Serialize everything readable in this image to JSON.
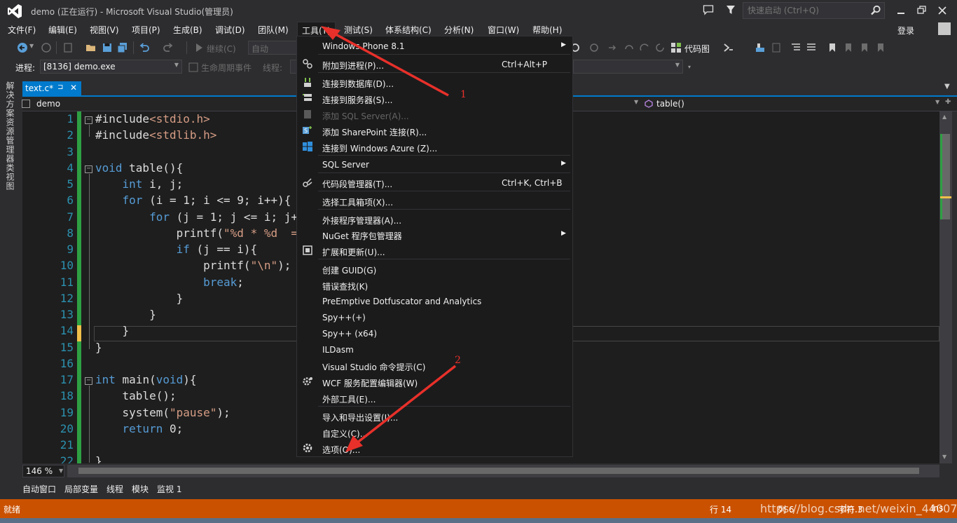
{
  "window": {
    "title": "demo (正在运行) - Microsoft Visual Studio(管理员)",
    "quick_launch_placeholder": "快速启动 (Ctrl+Q)",
    "login": "登录"
  },
  "menubar": {
    "items": [
      "文件(F)",
      "编辑(E)",
      "视图(V)",
      "项目(P)",
      "生成(B)",
      "调试(D)",
      "团队(M)",
      "工具(T)",
      "测试(S)",
      "体系结构(C)",
      "分析(N)",
      "窗口(W)",
      "帮助(H)"
    ]
  },
  "toolbar1": {
    "continue": "继续(C)",
    "config": "自动",
    "codemap": "代码图"
  },
  "toolbar2": {
    "process_label": "进程:",
    "process_value": "[8136] demo.exe",
    "lifecycle": "生命周期事件",
    "thread_label": "线程:"
  },
  "left_strip": {
    "tabs": [
      "解决方案资源管理器",
      "类视图"
    ]
  },
  "doc_tab": {
    "name": "text.c*",
    "pin": "⊐",
    "close": "✕"
  },
  "navbar": {
    "project": "demo",
    "member": "table()"
  },
  "editor": {
    "line_numbers": [
      "1",
      "2",
      "3",
      "4",
      "5",
      "6",
      "7",
      "8",
      "9",
      "10",
      "11",
      "12",
      "13",
      "14",
      "15",
      "16",
      "17",
      "18",
      "19",
      "20",
      "21",
      "22"
    ],
    "lines": [
      [
        [
          "t",
          "#include"
        ],
        [
          "s",
          "<stdio.h>"
        ]
      ],
      [
        [
          "t",
          "#include"
        ],
        [
          "s",
          "<stdlib.h>"
        ]
      ],
      [],
      [
        [
          "k",
          "void"
        ],
        [
          "t",
          " table(){"
        ]
      ],
      [
        [
          "t",
          "    "
        ],
        [
          "k",
          "int"
        ],
        [
          "t",
          " i, j;"
        ]
      ],
      [
        [
          "t",
          "    "
        ],
        [
          "k",
          "for"
        ],
        [
          "t",
          " (i = 1; i <= 9; i++){"
        ]
      ],
      [
        [
          "t",
          "        "
        ],
        [
          "k",
          "for"
        ],
        [
          "t",
          " (j = 1; j <= i; j++){"
        ]
      ],
      [
        [
          "t",
          "            printf("
        ],
        [
          "s",
          "\"%d * %d  ="
        ]
      ],
      [
        [
          "t",
          "            "
        ],
        [
          "k",
          "if"
        ],
        [
          "t",
          " (j == i){"
        ]
      ],
      [
        [
          "t",
          "                printf("
        ],
        [
          "s",
          "\"\\n\""
        ],
        [
          "t",
          ");"
        ]
      ],
      [
        [
          "t",
          "                "
        ],
        [
          "k",
          "break"
        ],
        [
          "t",
          ";"
        ]
      ],
      [
        [
          "t",
          "            }"
        ]
      ],
      [
        [
          "t",
          "        }"
        ]
      ],
      [
        [
          "t",
          "    }"
        ]
      ],
      [
        [
          "t",
          "}"
        ]
      ],
      [],
      [
        [
          "k",
          "int"
        ],
        [
          "t",
          " main("
        ],
        [
          "k",
          "void"
        ],
        [
          "t",
          "){"
        ]
      ],
      [
        [
          "t",
          "    table();"
        ]
      ],
      [
        [
          "t",
          "    system("
        ],
        [
          "s",
          "\"pause\""
        ],
        [
          "t",
          ");"
        ]
      ],
      [
        [
          "t",
          "    "
        ],
        [
          "k",
          "return"
        ],
        [
          "t",
          " 0;"
        ]
      ],
      [],
      [
        [
          "t",
          "}"
        ]
      ]
    ],
    "zoom": "146 %"
  },
  "tools_menu": {
    "items": [
      {
        "label": "Windows Phone 8.1",
        "shortcut": "",
        "submenu": true,
        "icon": "",
        "disabled": false
      },
      {
        "label": "附加到进程(P)...",
        "shortcut": "Ctrl+Alt+P",
        "submenu": false,
        "icon": "attach-process-icon",
        "disabled": false
      },
      {
        "label": "连接到数据库(D)...",
        "shortcut": "",
        "submenu": false,
        "icon": "connect-database-icon",
        "disabled": false
      },
      {
        "label": "连接到服务器(S)...",
        "shortcut": "",
        "submenu": false,
        "icon": "connect-server-icon",
        "disabled": false
      },
      {
        "label": "添加 SQL Server(A)...",
        "shortcut": "",
        "submenu": false,
        "icon": "sql-server-icon",
        "disabled": true
      },
      {
        "label": "添加 SharePoint 连接(R)...",
        "shortcut": "",
        "submenu": false,
        "icon": "sharepoint-icon",
        "disabled": false
      },
      {
        "label": "连接到 Windows Azure (Z)...",
        "shortcut": "",
        "submenu": false,
        "icon": "windows-azure-icon",
        "disabled": false
      },
      {
        "label": "SQL Server",
        "shortcut": "",
        "submenu": true,
        "icon": "",
        "disabled": false
      },
      {
        "label": "代码段管理器(T)...",
        "shortcut": "Ctrl+K, Ctrl+B",
        "submenu": false,
        "icon": "snippet-manager-icon",
        "disabled": false
      },
      {
        "label": "选择工具箱项(X)...",
        "shortcut": "",
        "submenu": false,
        "icon": "",
        "disabled": false
      },
      {
        "label": "外接程序管理器(A)...",
        "shortcut": "",
        "submenu": false,
        "icon": "",
        "disabled": false
      },
      {
        "label": "NuGet 程序包管理器",
        "shortcut": "",
        "submenu": true,
        "icon": "",
        "disabled": false
      },
      {
        "label": "扩展和更新(U)...",
        "shortcut": "",
        "submenu": false,
        "icon": "extensions-icon",
        "disabled": false
      },
      {
        "label": "创建 GUID(G)",
        "shortcut": "",
        "submenu": false,
        "icon": "",
        "disabled": false
      },
      {
        "label": "错误查找(K)",
        "shortcut": "",
        "submenu": false,
        "icon": "",
        "disabled": false
      },
      {
        "label": "PreEmptive Dotfuscator and Analytics",
        "shortcut": "",
        "submenu": false,
        "icon": "",
        "disabled": false
      },
      {
        "label": "Spy++(+)",
        "shortcut": "",
        "submenu": false,
        "icon": "",
        "disabled": false
      },
      {
        "label": "Spy++ (x64)",
        "shortcut": "",
        "submenu": false,
        "icon": "",
        "disabled": false
      },
      {
        "label": "ILDasm",
        "shortcut": "",
        "submenu": false,
        "icon": "",
        "disabled": false
      },
      {
        "label": "Visual Studio 命令提示(C)",
        "shortcut": "",
        "submenu": false,
        "icon": "",
        "disabled": false
      },
      {
        "label": "WCF 服务配置编辑器(W)",
        "shortcut": "",
        "submenu": false,
        "icon": "wcf-config-icon",
        "disabled": false
      },
      {
        "label": "外部工具(E)...",
        "shortcut": "",
        "submenu": false,
        "icon": "",
        "disabled": false
      },
      {
        "label": "导入和导出设置(I)...",
        "shortcut": "",
        "submenu": false,
        "icon": "",
        "disabled": false
      },
      {
        "label": "自定义(C)...",
        "shortcut": "",
        "submenu": false,
        "icon": "",
        "disabled": false
      },
      {
        "label": "选项(O)...",
        "shortcut": "",
        "submenu": false,
        "icon": "gear-icon",
        "disabled": false
      }
    ]
  },
  "bottom_tabs": [
    "自动窗口",
    "局部变量",
    "线程",
    "模块",
    "监视 1"
  ],
  "statusbar": {
    "ready": "就绪",
    "line": "行 14",
    "col": "列 6",
    "char": "字符 3",
    "ins": "Ins"
  },
  "annotations": {
    "arrow1_label": "1",
    "arrow2_label": "2",
    "color": "#e8302a"
  },
  "watermark": "https://blog.csdn.net/weixin_44007143",
  "colors": {
    "accent": "#007acc",
    "status_debug": "#ca5100",
    "keyword": "#569cd6",
    "string": "#d69d85",
    "line_number": "#2b91af"
  }
}
